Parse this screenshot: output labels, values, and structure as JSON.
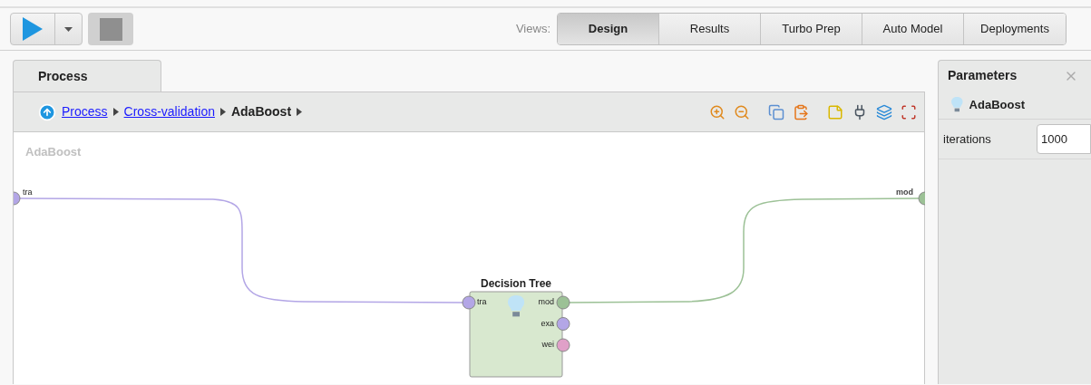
{
  "toolbar": {
    "views_label": "Views:",
    "views": [
      {
        "label": "Design",
        "selected": true
      },
      {
        "label": "Results",
        "selected": false
      },
      {
        "label": "Turbo Prep",
        "selected": false
      },
      {
        "label": "Auto Model",
        "selected": false
      },
      {
        "label": "Deployments",
        "selected": false
      }
    ]
  },
  "process_tab": {
    "label": "Process",
    "selected": true
  },
  "breadcrumb": [
    {
      "label": "Process",
      "kind": "link"
    },
    {
      "label": "Cross-validation",
      "kind": "link"
    },
    {
      "label": "AdaBoost",
      "kind": "current"
    }
  ],
  "canvas": {
    "title": "AdaBoost",
    "input_ports": [
      {
        "label": "tra",
        "color": "#b3a6e6"
      }
    ],
    "output_ports": [
      {
        "label": "mod",
        "color": "#9cc196"
      }
    ],
    "operator": {
      "name": "Decision Tree",
      "inputs": [
        {
          "label": "tra",
          "color": "#b3a6e6"
        }
      ],
      "outputs": [
        {
          "label": "mod",
          "color": "#9cc196"
        },
        {
          "label": "exa",
          "color": "#b3a6e6"
        },
        {
          "label": "wei",
          "color": "#e0a0c8"
        }
      ]
    }
  },
  "parameters": {
    "title": "Parameters",
    "operator": "AdaBoost",
    "fields": [
      {
        "label": "iterations",
        "value": "1000"
      }
    ]
  }
}
